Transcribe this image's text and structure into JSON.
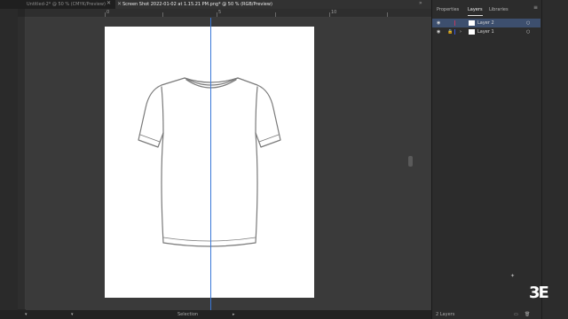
{
  "tabs": [
    {
      "label": "Untitled-2* @ 50 % (CMYK/Preview)",
      "active": false
    },
    {
      "label": "Screen Shot 2022-01-02 at 1.15.21 PM.png* @ 50 % (RGB/Preview)",
      "active": true
    }
  ],
  "ruler": {
    "ticks": [
      "0",
      "5",
      "10"
    ]
  },
  "statusbar": {
    "selection_label": "Selection"
  },
  "panel": {
    "tabs": [
      "Properties",
      "Layers",
      "Libraries"
    ],
    "layers": [
      {
        "name": "Layer 2",
        "color": "#c0395f",
        "selected": true
      },
      {
        "name": "Layer 1",
        "color": "#3a58d8",
        "selected": false
      }
    ],
    "footer_count": "2 Layers"
  },
  "watermark_text": "3E"
}
